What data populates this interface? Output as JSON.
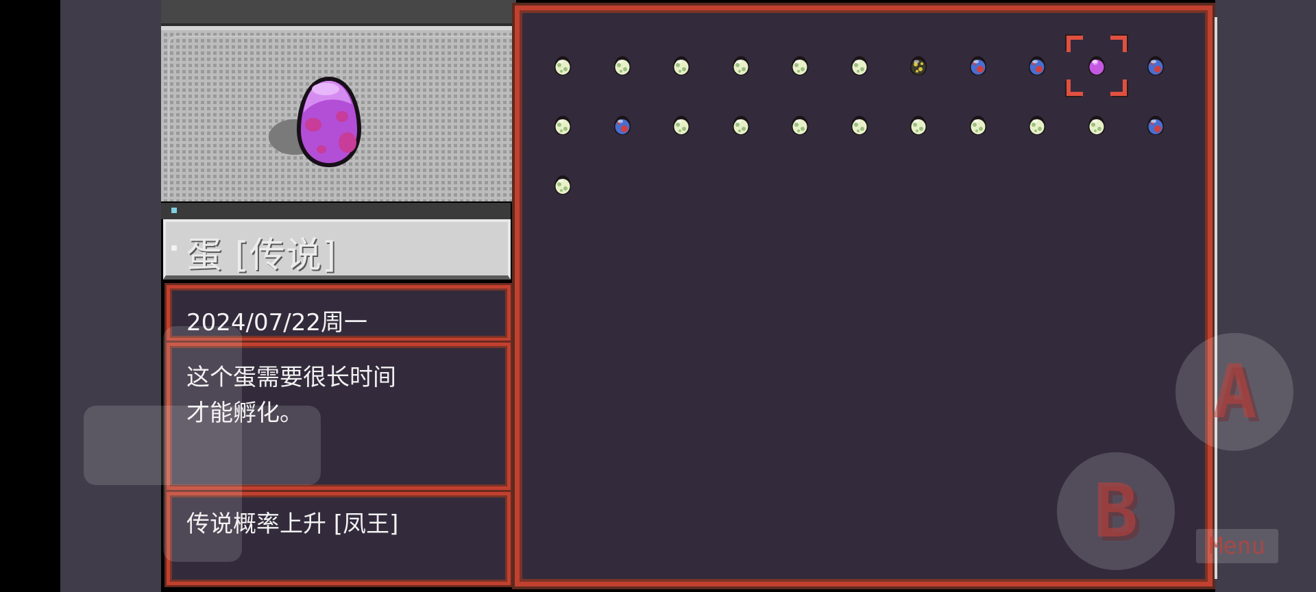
{
  "selected_egg": {
    "name": "蛋 [传说]",
    "date": "2024/07/22周一",
    "description_lines": [
      "这个蛋需要很长时间",
      "才能孵化。"
    ],
    "bonus": "传说概率上升 [凤王]"
  },
  "egg_grid": {
    "rows": [
      [
        "common",
        "common",
        "common",
        "common",
        "common",
        "common",
        "rare",
        "epic",
        "epic",
        "legendary",
        "epic"
      ],
      [
        "common",
        "epic",
        "common",
        "common",
        "common",
        "common",
        "common",
        "common",
        "common",
        "common",
        "epic"
      ],
      [
        "common"
      ]
    ],
    "selected": {
      "row": 0,
      "col": 9
    }
  },
  "controls": {
    "a_label": "A",
    "b_label": "B",
    "menu_label": "Menu"
  },
  "colors": {
    "panel_bg": "#332b3c",
    "frame_red": "#c2402f",
    "legendary_egg": "#c458e0",
    "common_egg": "#e8f0c8",
    "epic_egg": "#4a6ed0",
    "rare_egg": "#3a3a2a"
  }
}
